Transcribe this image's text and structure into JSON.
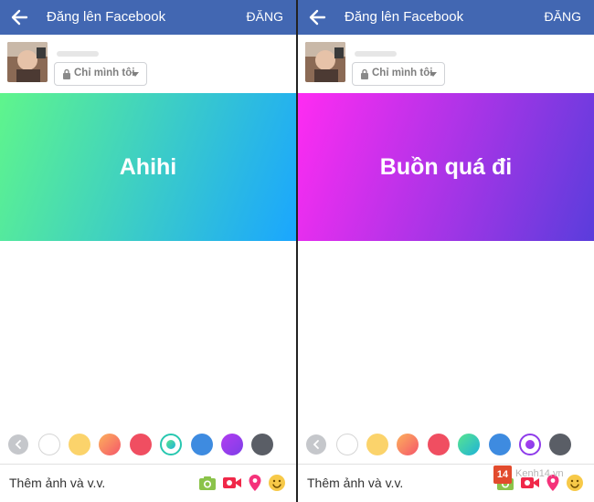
{
  "panels": [
    {
      "appbar": {
        "title": "Đăng lên Facebook",
        "post_label": "ĐĂNG"
      },
      "privacy": {
        "label": "Chỉ mình tôi"
      },
      "banner": {
        "text": "Ahihi",
        "gradient": [
          "#5ff58c",
          "#1aa6ff"
        ]
      },
      "selected_color": "teal-gradient",
      "bottom": {
        "add_label": "Thêm ảnh và v.v."
      }
    },
    {
      "appbar": {
        "title": "Đăng lên Facebook",
        "post_label": "ĐĂNG"
      },
      "privacy": {
        "label": "Chỉ mình tôi"
      },
      "banner": {
        "text": "Buồn quá đi",
        "gradient": [
          "#ff2bf2",
          "#5a3ddc"
        ]
      },
      "selected_color": "purple-gradient",
      "bottom": {
        "add_label": "Thêm ảnh và v.v."
      }
    }
  ],
  "color_options": [
    "white",
    "yellow",
    "orange-gradient",
    "red",
    "teal-gradient",
    "blue",
    "purple-gradient",
    "dark-gray"
  ],
  "colors": {
    "appbar": "#4267b2",
    "white": "#ffffff",
    "yellow": "#fbd36b",
    "orange_gradient": [
      "#fcb15c",
      "#f5566a"
    ],
    "red": "#f04e61",
    "teal_gradient": [
      "#58e48f",
      "#1fb3d8"
    ],
    "blue": "#3e8be0",
    "purple_gradient": [
      "#b23cf0",
      "#7d3fe8"
    ],
    "dark_gray": "#5a5e66",
    "camera": "#8bc34a",
    "video": "#f02849",
    "location": "#f5327a",
    "feeling": "#f7c948"
  },
  "icons": [
    "back-arrow-icon",
    "lock-icon",
    "caret-down-icon",
    "chevron-left-icon",
    "camera-icon",
    "video-camera-icon",
    "location-pin-icon",
    "smiley-icon"
  ],
  "watermark": {
    "badge": "14",
    "text": "Kenh14.vn"
  }
}
